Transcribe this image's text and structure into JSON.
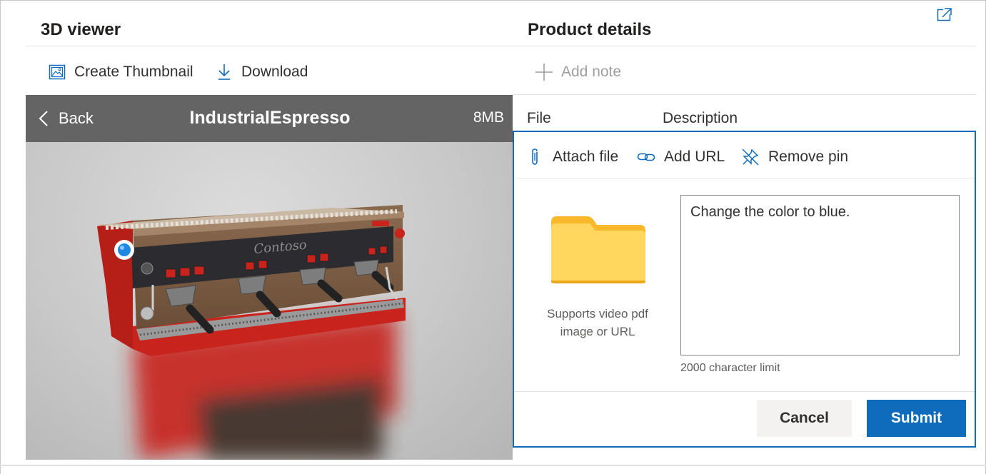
{
  "viewer": {
    "title": "3D viewer",
    "toolbar": {
      "create_thumbnail": "Create Thumbnail",
      "download": "Download"
    },
    "model_bar": {
      "back_label": "Back",
      "model_name": "IndustrialEspresso",
      "model_size": "8MB"
    },
    "model_brand": "Contoso"
  },
  "details": {
    "title": "Product details",
    "add_note": "Add note",
    "columns": [
      "File",
      "Description"
    ],
    "note_panel": {
      "tools": {
        "attach_file": "Attach file",
        "add_url": "Add URL",
        "remove_pin": "Remove pin"
      },
      "support_text": "Supports video pdf image or URL",
      "description_value": "Change the color to blue.",
      "char_limit": "2000 character limit",
      "cancel_label": "Cancel",
      "submit_label": "Submit"
    }
  },
  "colors": {
    "accent": "#0f6cbd",
    "machine_red": "#c8231c",
    "folder_yellow": "#ffd75e"
  }
}
